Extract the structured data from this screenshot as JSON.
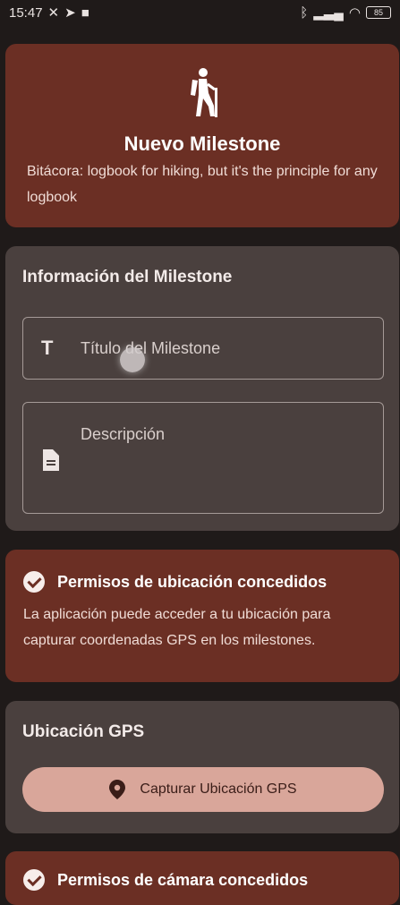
{
  "status_bar": {
    "time": "15:47",
    "battery": "85"
  },
  "hero": {
    "title": "Nuevo Milestone",
    "subtitle": "Bitácora: logbook for hiking, but it's the principle for any logbook",
    "icon": "hiking-icon"
  },
  "info": {
    "section_title": "Información del Milestone",
    "title_placeholder": "Título del Milestone",
    "description_placeholder": "Descripción"
  },
  "location_permission": {
    "title": "Permisos de ubicación concedidos",
    "text": "La aplicación puede acceder a tu ubicación para capturar coordenadas GPS en los milestones."
  },
  "gps": {
    "section_title": "Ubicación GPS",
    "capture_label": "Capturar Ubicación GPS"
  },
  "camera_permission": {
    "title": "Permisos de cámara concedidos"
  },
  "colors": {
    "accent_card": "#6b2f24",
    "neutral_card": "#4a403e",
    "button": "#d9a69a",
    "background": "#1f1a19"
  }
}
